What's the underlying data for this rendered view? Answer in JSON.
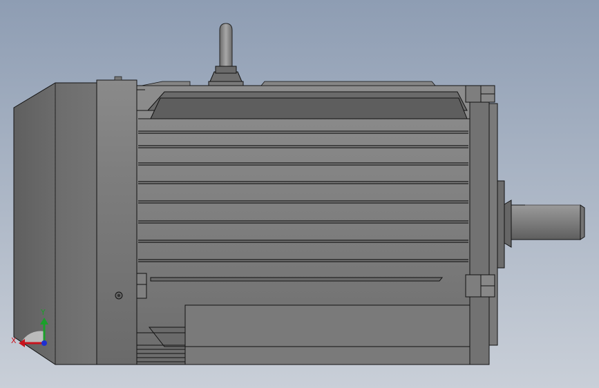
{
  "scene": {
    "model": "electric-motor",
    "view": "side-orthographic",
    "background_top": "#8e9db3",
    "background_bottom": "#c9cfd8",
    "body_color": "#7c7c7c",
    "edge_color": "#111111"
  },
  "triad": {
    "x_label": "X",
    "y_label": "Y",
    "x_color": "#c8141e",
    "y_color": "#1aa02a",
    "z_color": "#1f2fd0"
  }
}
